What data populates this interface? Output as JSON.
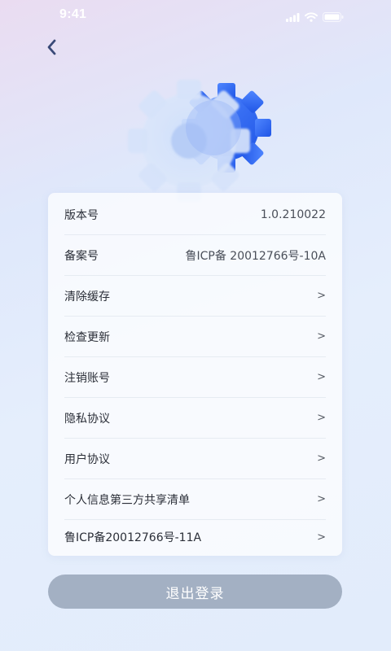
{
  "status_bar": {
    "time": "9:41",
    "icons": [
      "signal-icon",
      "wifi-icon",
      "battery-icon"
    ]
  },
  "header": {
    "back_icon": "chevron-left-icon"
  },
  "hero": {
    "icon": "gear-icon",
    "accent_color": "#2f6cf0"
  },
  "settings": {
    "items": [
      {
        "label": "版本号",
        "value": "1.0.210022"
      },
      {
        "label": "备案号",
        "value": "鲁ICP备 20012766号-10A"
      },
      {
        "label": "清除缓存",
        "chevron": ">"
      },
      {
        "label": "检查更新",
        "chevron": ">"
      },
      {
        "label": "注销账号",
        "chevron": ">"
      },
      {
        "label": "隐私协议",
        "chevron": ">"
      },
      {
        "label": "用户协议",
        "chevron": ">"
      },
      {
        "label": "个人信息第三方共享清单",
        "chevron": ">"
      },
      {
        "label": "鲁ICP备20012766号-11A",
        "chevron": ">"
      }
    ]
  },
  "logout": {
    "label": "退出登录",
    "color": "#a3b0c3"
  }
}
